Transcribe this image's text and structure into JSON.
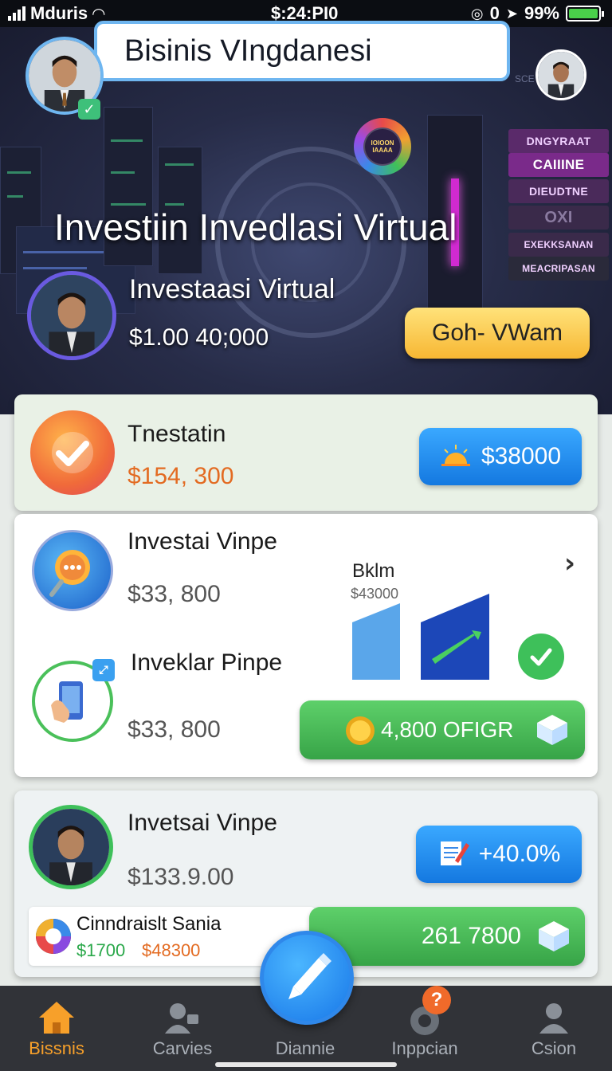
{
  "status_bar": {
    "carrier": "Mduris",
    "time": "$:24:PI0",
    "indicators": "0",
    "battery": "99%",
    "battery_level": 0.99
  },
  "header": {
    "title": "Bisinis VIngdanesi"
  },
  "hero": {
    "heading": "Investiin Invedlasi Virtual",
    "subtitle": "Investaasi Virtual",
    "amount": "$1.00 40;000",
    "cta_label": "Goh- VWam",
    "gear_badge_text": "IOIOON IAAAA",
    "side_panels": [
      "DNGYRAAT",
      "CAIIINE",
      "DIEUDTNE",
      "OXI",
      "EXEKKSANAN",
      "MEACRIPASAN"
    ],
    "corner_text": "SCE"
  },
  "cards": {
    "card1": {
      "label": "Tnestatin",
      "amount": "$154, 300",
      "pill_label": "$38000"
    },
    "card2": {
      "row1_label": "Investai Vinpe",
      "row1_amount": "$33, 800",
      "chart_title": "Bklm",
      "chart_sub": "$43000",
      "row2_label": "Inveklar Pinpe",
      "row2_amount": "$33, 800",
      "pill_label": "4,800 OFIGR"
    },
    "card3": {
      "label": "Invetsai Vinpe",
      "amount": "$133.9.00",
      "pill_label": "+40.0%",
      "sub_label": "Cinndraislt Sania",
      "sub_amount_green": "$1700",
      "sub_amount_orange": "$48300",
      "pill2_label": "261 7800"
    }
  },
  "nav": {
    "items": [
      {
        "label": "Bissnis",
        "icon": "home-icon"
      },
      {
        "label": "Carvies",
        "icon": "person-camera-icon"
      },
      {
        "label": "Diannie",
        "icon": "pen-icon"
      },
      {
        "label": "Inppcian",
        "icon": "help-icon",
        "badge": "?"
      },
      {
        "label": "Csion",
        "icon": "profile-icon"
      }
    ]
  },
  "colors": {
    "accent_blue": "#1478e0",
    "accent_green": "#37a447",
    "gold": "#f7b733",
    "orange": "#e36b22"
  }
}
